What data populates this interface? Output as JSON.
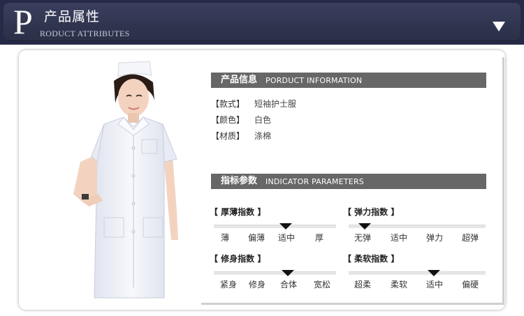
{
  "header": {
    "big_letter": "P",
    "title": "产品属性",
    "subtitle": "RODUCT ATTRIBUTES",
    "dropdown_icon": "triangle-down-icon"
  },
  "product_info": {
    "title_cn": "产品信息",
    "title_en": "PORDUCT INFORMATION",
    "rows": [
      {
        "label": "【款式】",
        "value": "短袖护士服"
      },
      {
        "label": "【颜色】",
        "value": "白色"
      },
      {
        "label": "【材质】",
        "value": "涤棉"
      }
    ]
  },
  "indicators": {
    "title_cn": "指标参数",
    "title_en": "INDICATOR  PARAMETERS",
    "groups": [
      {
        "name": "【 厚薄指数 】",
        "options": [
          "薄",
          "偏薄",
          "适中",
          "厚"
        ],
        "selected": "适中"
      },
      {
        "name": "【 弹力指数 】",
        "options": [
          "无弹",
          "适中",
          "弹力",
          "超弹"
        ],
        "selected": "无弹"
      },
      {
        "name": "【 修身指数 】",
        "options": [
          "紧身",
          "修身",
          "合体",
          "宽松"
        ],
        "selected": "合体"
      },
      {
        "name": "【 柔软指数 】",
        "options": [
          "超柔",
          "柔软",
          "适中",
          "偏硬"
        ],
        "selected": "适中"
      }
    ]
  },
  "colors": {
    "banner": "#30354f",
    "section_header": "#676767",
    "marker": "#111111"
  }
}
